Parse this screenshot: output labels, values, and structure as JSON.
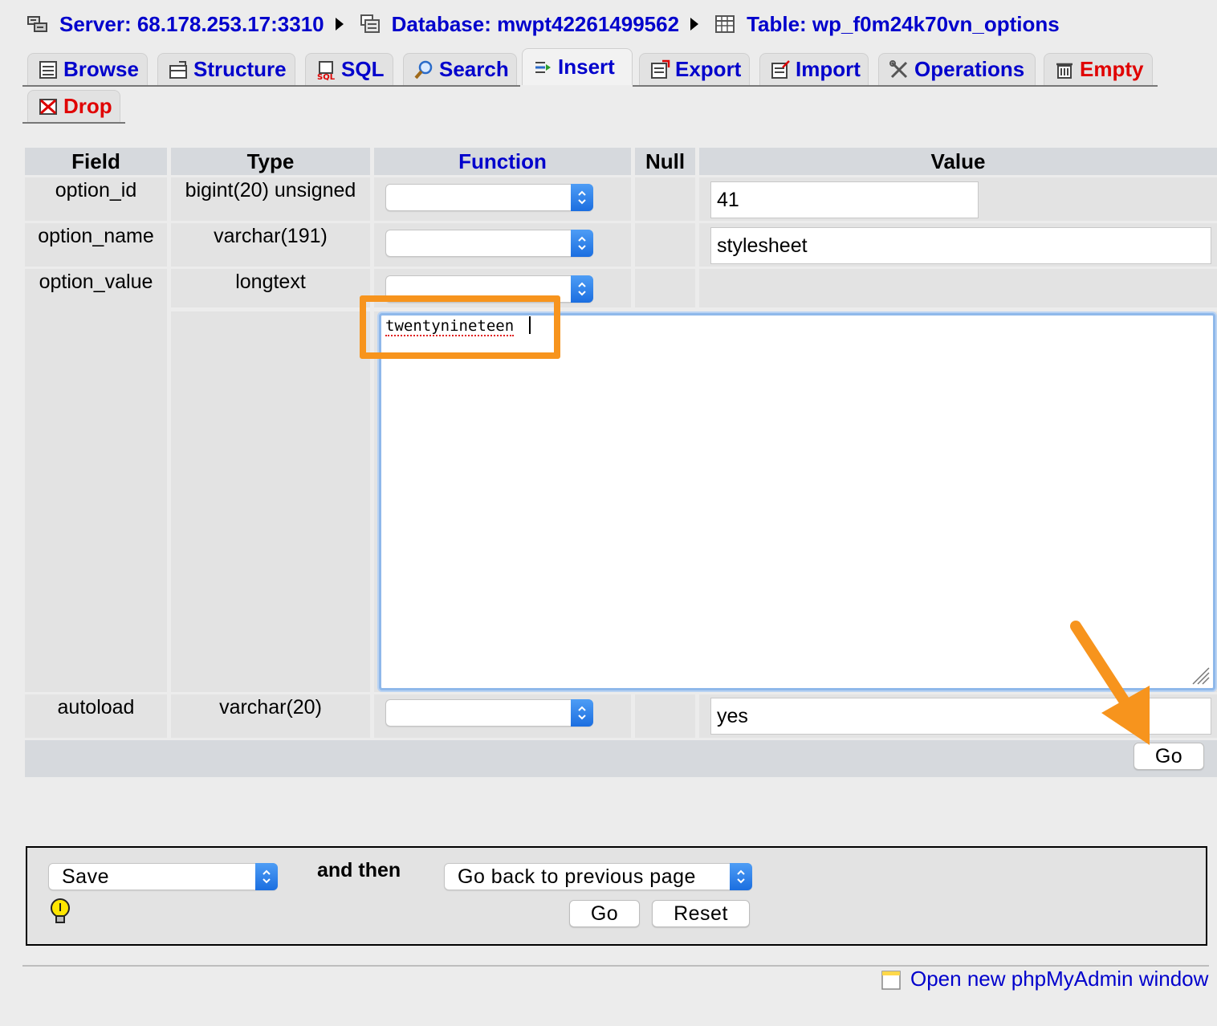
{
  "breadcrumb": {
    "server": "Server: 68.178.253.17:3310",
    "database": "Database: mwpt42261499562",
    "table": "Table: wp_f0m24k70vn_options"
  },
  "tabs": [
    {
      "label": "Browse",
      "icon": "browse-icon"
    },
    {
      "label": "Structure",
      "icon": "structure-icon"
    },
    {
      "label": "SQL",
      "icon": "sql-icon"
    },
    {
      "label": "Search",
      "icon": "search-icon"
    },
    {
      "label": "Insert",
      "icon": "insert-icon",
      "active": true
    },
    {
      "label": "Export",
      "icon": "export-icon"
    },
    {
      "label": "Import",
      "icon": "import-icon"
    },
    {
      "label": "Operations",
      "icon": "operations-icon"
    },
    {
      "label": "Empty",
      "icon": "empty-icon"
    },
    {
      "label": "Drop",
      "icon": "drop-icon"
    }
  ],
  "table": {
    "headers": {
      "field": "Field",
      "type": "Type",
      "function": "Function",
      "null": "Null",
      "value": "Value"
    },
    "rows": [
      {
        "field": "option_id",
        "type": "bigint(20) unsigned",
        "function": "",
        "value": "41"
      },
      {
        "field": "option_name",
        "type": "varchar(191)",
        "function": "",
        "value": "stylesheet"
      },
      {
        "field": "option_value",
        "type": "longtext",
        "function": "",
        "value": "twentynineteen"
      },
      {
        "field": "autoload",
        "type": "varchar(20)",
        "function": "",
        "value": "yes"
      }
    ],
    "go_label": "Go"
  },
  "after_insert": {
    "action_select": "Save",
    "and_then": "and then",
    "then_select": "Go back to previous page",
    "go_label": "Go",
    "reset_label": "Reset"
  },
  "footer": {
    "open_new_window": "Open new phpMyAdmin window"
  },
  "colors": {
    "link": "#0000cc",
    "danger": "#e00000",
    "highlight": "#f7941d",
    "header_bg": "#d6d9dd",
    "cell_bg": "#e3e3e3"
  }
}
